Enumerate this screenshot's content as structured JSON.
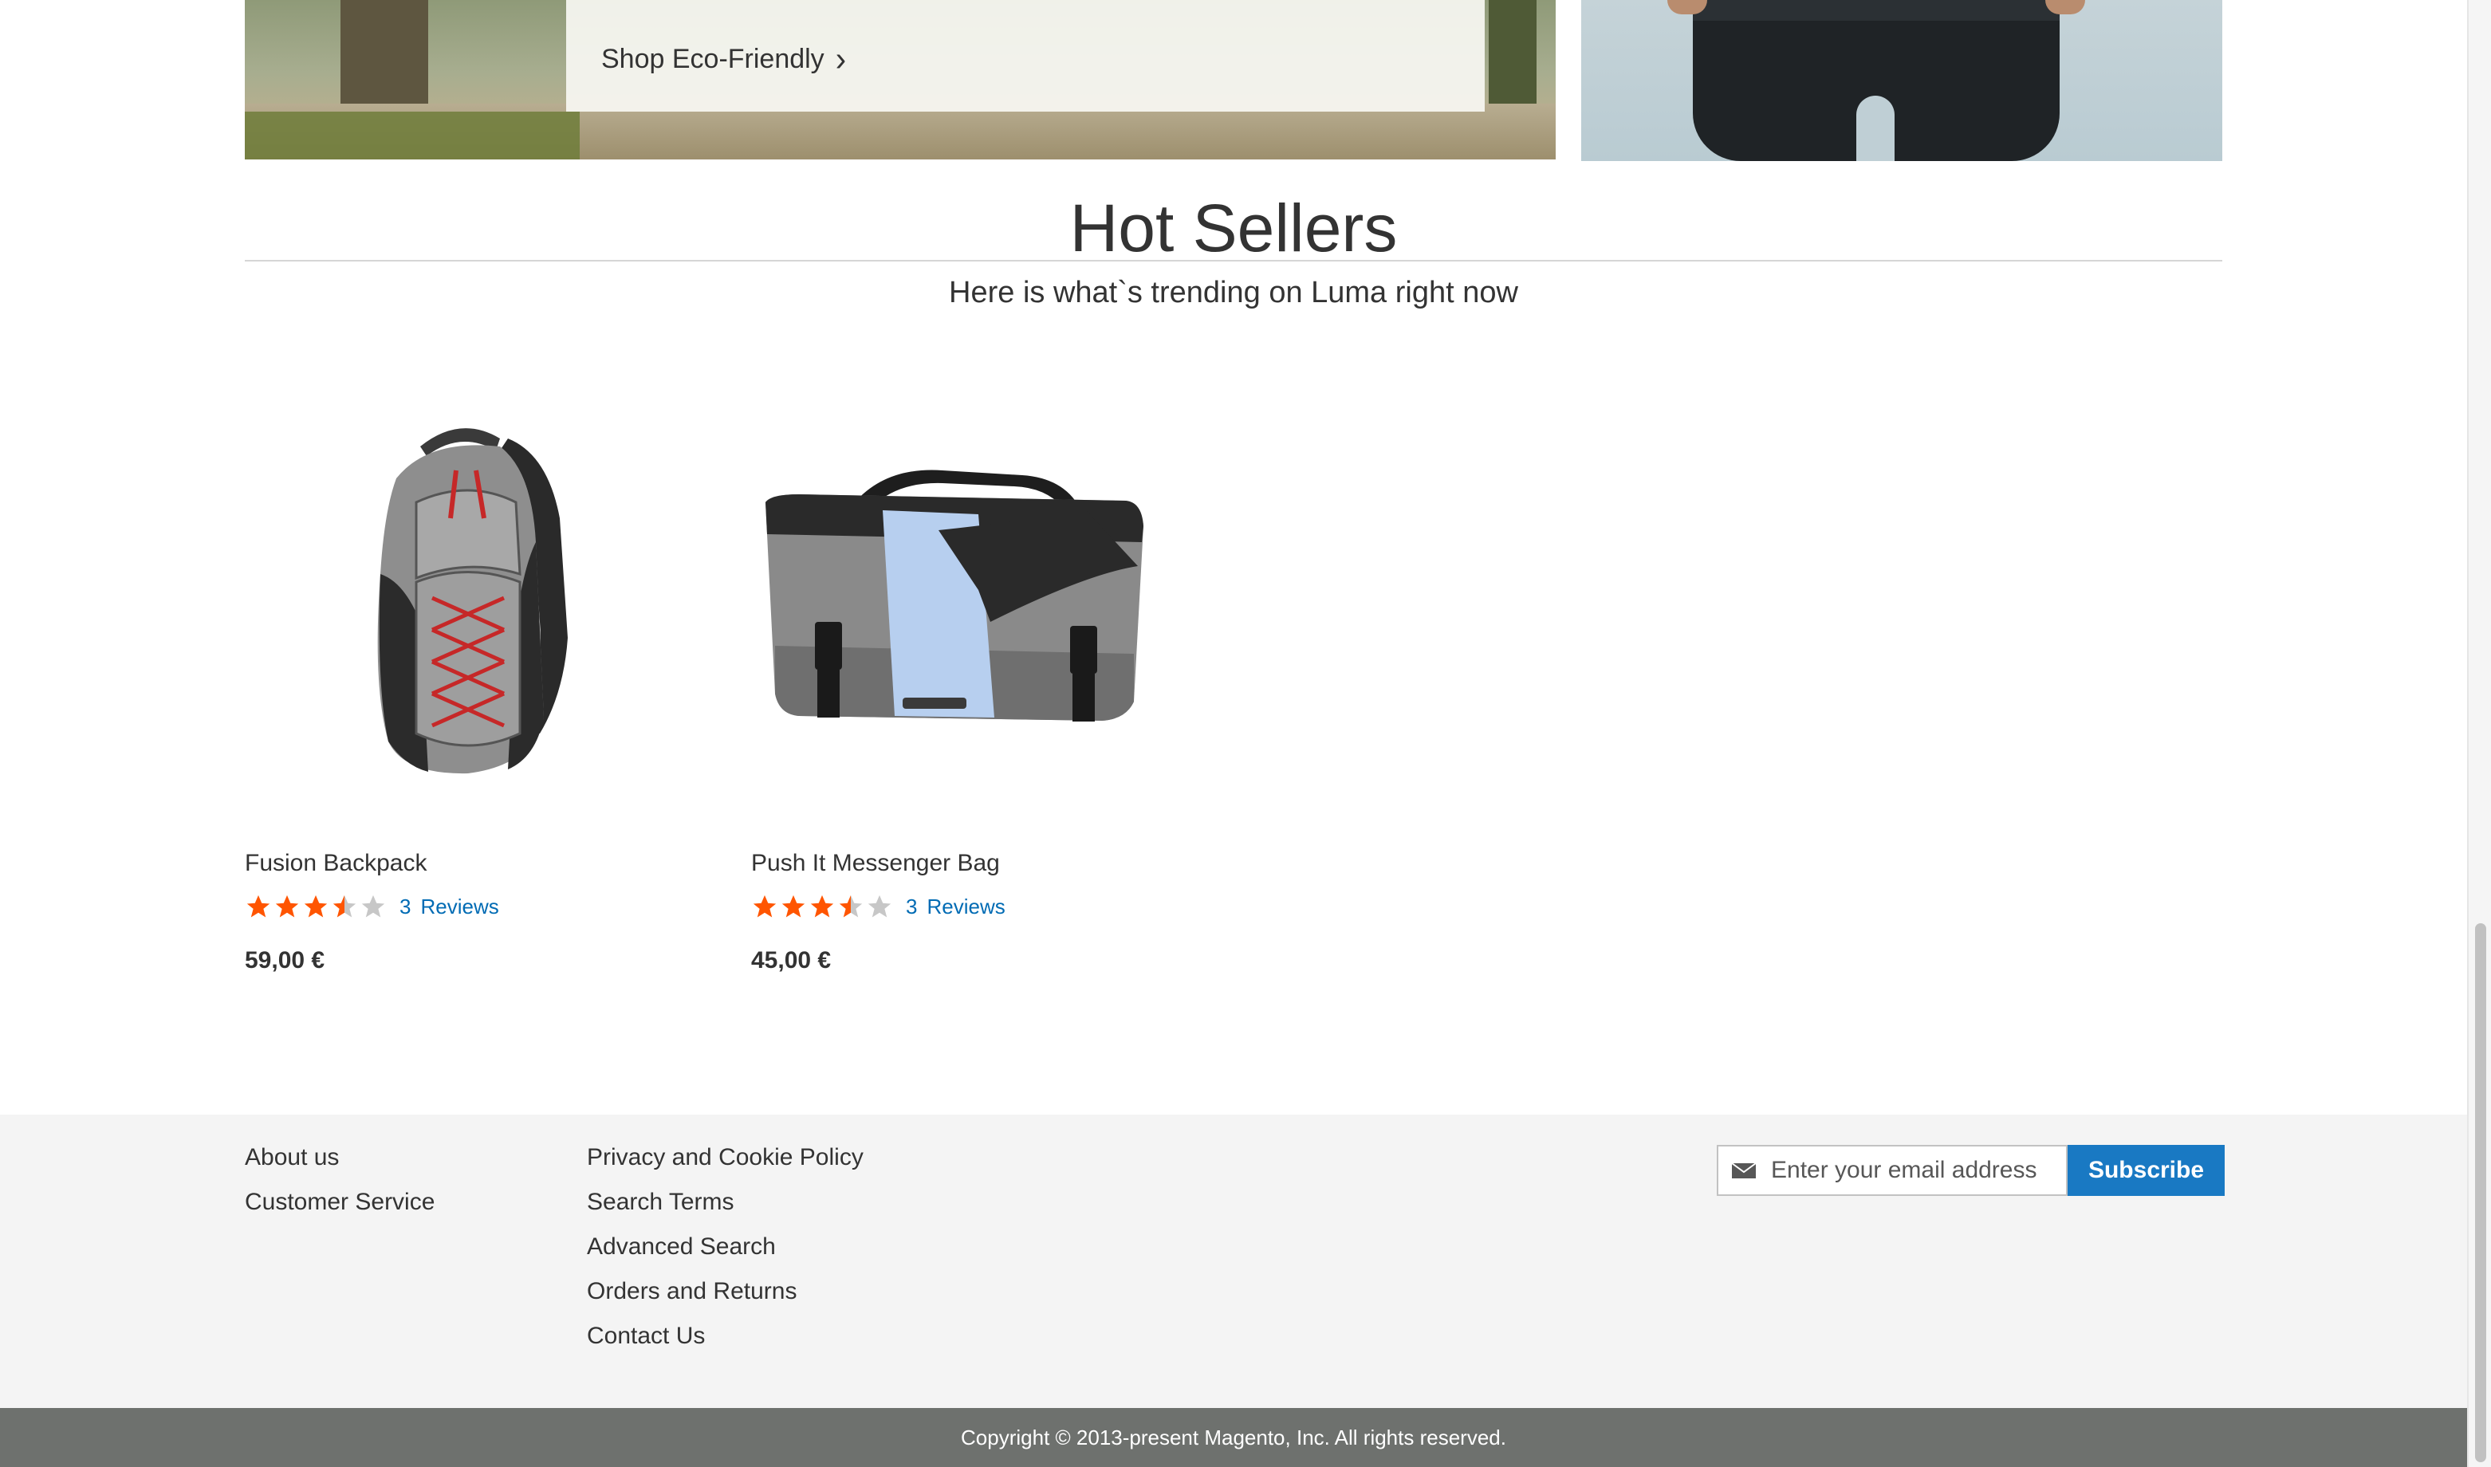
{
  "promo": {
    "eco_link": "Shop Eco-Friendly"
  },
  "hot_sellers": {
    "title": "Hot Sellers",
    "subtitle": "Here is what`s trending on Luma right now"
  },
  "products": [
    {
      "name": "Fusion Backpack",
      "rating_stars": 3.5,
      "reviews_count": "3",
      "reviews_label": "Reviews",
      "price": "59,00 €"
    },
    {
      "name": "Push It Messenger Bag",
      "rating_stars": 3.5,
      "reviews_count": "3",
      "reviews_label": "Reviews",
      "price": "45,00 €"
    }
  ],
  "footer": {
    "col1": [
      "About us",
      "Customer Service"
    ],
    "col2": [
      "Privacy and Cookie Policy",
      "Search Terms",
      "Advanced Search",
      "Orders and Returns",
      "Contact Us"
    ],
    "newsletter": {
      "placeholder": "Enter your email address",
      "button": "Subscribe"
    },
    "copyright": "Copyright © 2013-present Magento, Inc. All rights reserved."
  },
  "colors": {
    "star": "#ff5501",
    "star_empty": "#c7c7c7",
    "link": "#006bb4",
    "button": "#1979c3",
    "footer_bg": "#f4f4f4",
    "copyright_bg": "#6e716e"
  },
  "icons": {
    "chevron": "chevron-right-icon",
    "mail": "envelope-icon",
    "star": "star-icon"
  }
}
